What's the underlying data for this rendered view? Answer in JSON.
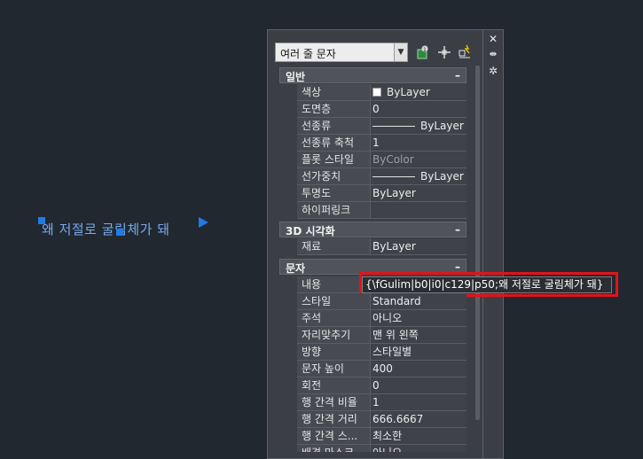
{
  "canvas": {
    "text": "왜 저절로 굴림체가 돼",
    "accent": "#1e7be8"
  },
  "palette": {
    "object_select": "여러 줄 문자",
    "categories": [
      {
        "label": "일반",
        "toggle": "–"
      },
      {
        "label": "3D 시각화",
        "toggle": "–"
      },
      {
        "label": "문자",
        "toggle": "–"
      }
    ],
    "general": [
      {
        "name": "색상",
        "value": "ByLayer"
      },
      {
        "name": "도면층",
        "value": "0"
      },
      {
        "name": "선종류",
        "value": "ByLayer"
      },
      {
        "name": "선종류 축척",
        "value": "1"
      },
      {
        "name": "플롯 스타일",
        "value": "ByColor"
      },
      {
        "name": "선가중치",
        "value": "ByLayer"
      },
      {
        "name": "투명도",
        "value": "ByLayer"
      },
      {
        "name": "하이퍼링크",
        "value": ""
      }
    ],
    "visual3d": [
      {
        "name": "재료",
        "value": "ByLayer"
      }
    ],
    "text": [
      {
        "name": "내용",
        "value": "{\\fGulim|b0|i0|c129|p50;왜 저절로 굴림체가 돼}"
      },
      {
        "name": "스타일",
        "value": "Standard"
      },
      {
        "name": "주석",
        "value": "아니오"
      },
      {
        "name": "자리맞추기",
        "value": "맨 위 왼쪽"
      },
      {
        "name": "방향",
        "value": "스타일별"
      },
      {
        "name": "문자 높이",
        "value": "400"
      },
      {
        "name": "회전",
        "value": "0"
      },
      {
        "name": "행 간격 비율",
        "value": "1"
      },
      {
        "name": "행 간격 거리",
        "value": "666.6667"
      },
      {
        "name": "행 간격 스...",
        "value": "최소한"
      },
      {
        "name": "배경 마스크",
        "value": "아니오"
      }
    ],
    "highlight_color": "#e3121b"
  }
}
